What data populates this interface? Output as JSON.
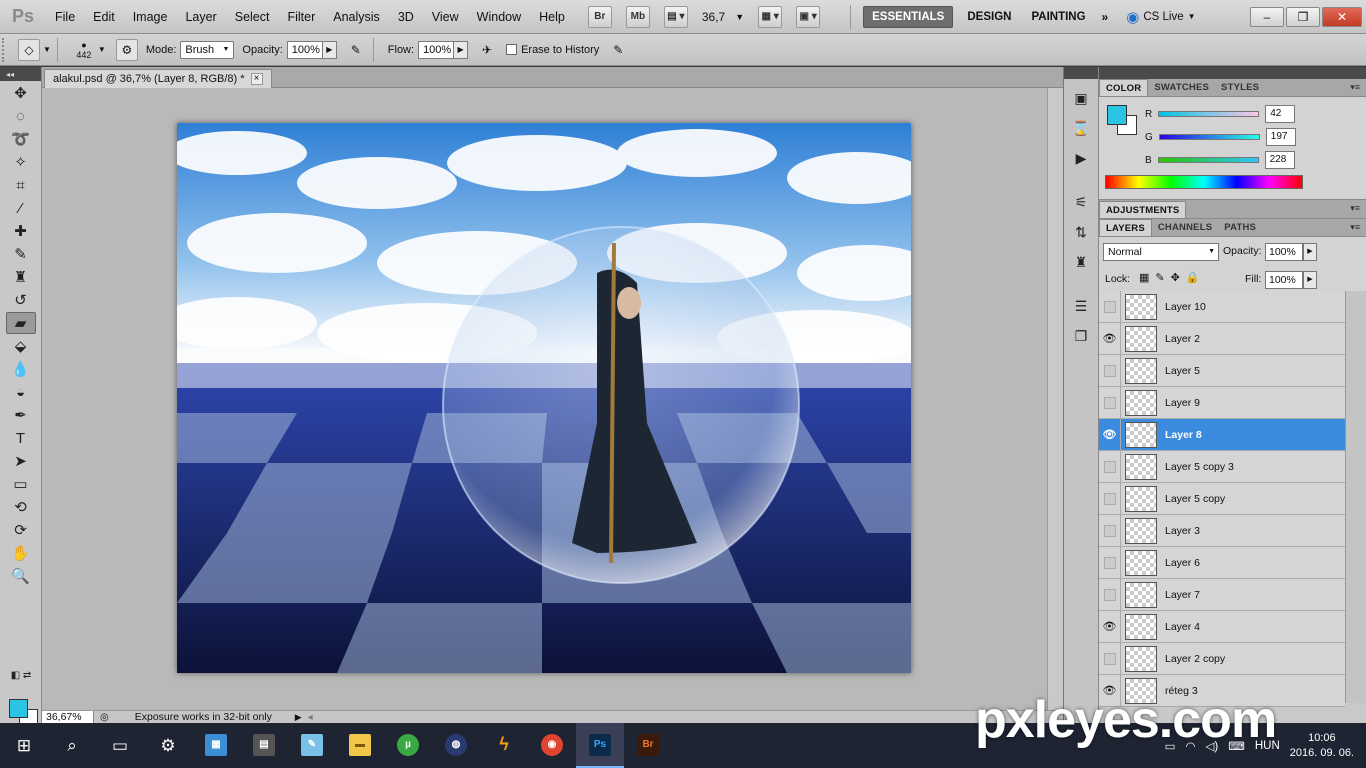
{
  "app": {
    "logo": "Ps"
  },
  "menu": [
    "File",
    "Edit",
    "Image",
    "Layer",
    "Select",
    "Filter",
    "Analysis",
    "3D",
    "View",
    "Window",
    "Help"
  ],
  "appbar": {
    "br": "Br",
    "mb": "Mb",
    "zoom": "36,7"
  },
  "workspaces": [
    "ESSENTIALS",
    "DESIGN",
    "PAINTING"
  ],
  "cslive": "CS Live",
  "options": {
    "brush_size": "442",
    "mode_label": "Mode:",
    "mode_value": "Brush",
    "opacity_label": "Opacity:",
    "opacity_value": "100%",
    "flow_label": "Flow:",
    "flow_value": "100%",
    "erase_history": "Erase to History"
  },
  "document": {
    "tab_title": "alakul.psd @ 36,7% (Layer 8, RGB/8) *",
    "zoom": "36,67%",
    "status": "Exposure works in 32-bit only"
  },
  "colors": {
    "accent": "#2ac5e4",
    "selection": "#3b8be0"
  },
  "color_panel": {
    "tabs": [
      "COLOR",
      "SWATCHES",
      "STYLES"
    ],
    "r_label": "R",
    "g_label": "G",
    "b_label": "B",
    "r": "42",
    "g": "197",
    "b": "228"
  },
  "adjustments_tab": "ADJUSTMENTS",
  "layers_panel": {
    "tabs": [
      "LAYERS",
      "CHANNELS",
      "PATHS"
    ],
    "blend_mode": "Normal",
    "opacity_label": "Opacity:",
    "opacity": "100%",
    "lock_label": "Lock:",
    "fill_label": "Fill:",
    "fill": "100%",
    "layers": [
      {
        "name": "Layer 10",
        "visible": false,
        "selected": false
      },
      {
        "name": "Layer 2",
        "visible": true,
        "selected": false
      },
      {
        "name": "Layer 5",
        "visible": false,
        "selected": false
      },
      {
        "name": "Layer 9",
        "visible": false,
        "selected": false
      },
      {
        "name": "Layer 8",
        "visible": true,
        "selected": true
      },
      {
        "name": "Layer 5 copy 3",
        "visible": false,
        "selected": false
      },
      {
        "name": "Layer 5 copy",
        "visible": false,
        "selected": false
      },
      {
        "name": "Layer 3",
        "visible": false,
        "selected": false
      },
      {
        "name": "Layer 6",
        "visible": false,
        "selected": false
      },
      {
        "name": "Layer 7",
        "visible": false,
        "selected": false
      },
      {
        "name": "Layer 4",
        "visible": true,
        "selected": false
      },
      {
        "name": "Layer 2 copy",
        "visible": false,
        "selected": false
      },
      {
        "name": "réteg 3",
        "visible": true,
        "selected": false
      }
    ]
  },
  "taskbar": {
    "lang": "HUN",
    "time": "10:06",
    "date": "2016. 09. 06."
  },
  "watermark": "pxleyes.com"
}
